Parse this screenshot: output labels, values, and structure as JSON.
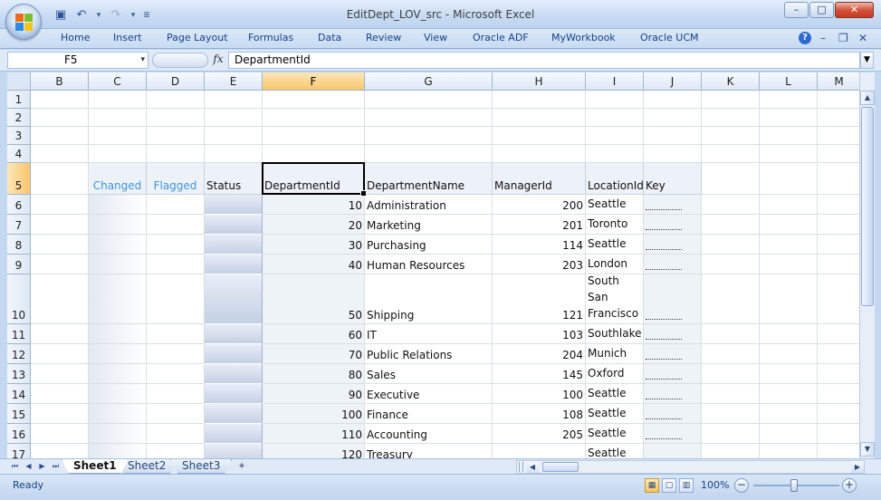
{
  "window": {
    "title": "EditDept_LOV_src - Microsoft Excel",
    "minimize_glyph": "–",
    "maximize_glyph": "□",
    "close_glyph": "✕",
    "doc_min_glyph": "–",
    "doc_restore_glyph": "❐",
    "doc_close_glyph": "✕"
  },
  "quick_access": {
    "save_icon": "▣",
    "undo_icon": "↶",
    "redo_icon": "↷",
    "dropdown_glyph": "▾",
    "customize_glyph": "≣"
  },
  "ribbon": {
    "tabs": [
      "Home",
      "Insert",
      "Page Layout",
      "Formulas",
      "Data",
      "Review",
      "View",
      "Oracle ADF",
      "MyWorkbook",
      "Oracle UCM"
    ],
    "help_icon": "?"
  },
  "formula_bar": {
    "name_box": "F5",
    "name_box_dropdown": "▾",
    "fx_label": "fx",
    "content": "DepartmentId",
    "expand_glyph": "▼"
  },
  "columns": [
    "B",
    "C",
    "D",
    "E",
    "F",
    "G",
    "H",
    "I",
    "J",
    "K",
    "L",
    "M"
  ],
  "selected_column": "F",
  "rows": [
    "1",
    "2",
    "3",
    "4",
    "5",
    "6",
    "7",
    "8",
    "9",
    "10",
    "11",
    "12",
    "13",
    "14",
    "15",
    "16",
    "17"
  ],
  "selected_row": "5",
  "table": {
    "headers": {
      "changed": "Changed",
      "flagged": "Flagged",
      "status": "Status",
      "department_id": "DepartmentId",
      "department_name": "DepartmentName",
      "manager_id": "ManagerId",
      "location_id": "LocationId",
      "key": "Key"
    },
    "records": [
      {
        "department_id": "10",
        "department_name": "Administration",
        "manager_id": "200",
        "location": "Seattle"
      },
      {
        "department_id": "20",
        "department_name": "Marketing",
        "manager_id": "201",
        "location": "Toronto"
      },
      {
        "department_id": "30",
        "department_name": "Purchasing",
        "manager_id": "114",
        "location": "Seattle"
      },
      {
        "department_id": "40",
        "department_name": "Human Resources",
        "manager_id": "203",
        "location": "London"
      },
      {
        "department_id": "50",
        "department_name": "Shipping",
        "manager_id": "121",
        "location": "South San Francisco"
      },
      {
        "department_id": "60",
        "department_name": "IT",
        "manager_id": "103",
        "location": "Southlake"
      },
      {
        "department_id": "70",
        "department_name": "Public Relations",
        "manager_id": "204",
        "location": "Munich"
      },
      {
        "department_id": "80",
        "department_name": "Sales",
        "manager_id": "145",
        "location": "Oxford"
      },
      {
        "department_id": "90",
        "department_name": "Executive",
        "manager_id": "100",
        "location": "Seattle"
      },
      {
        "department_id": "100",
        "department_name": "Finance",
        "manager_id": "108",
        "location": "Seattle"
      },
      {
        "department_id": "110",
        "department_name": "Accounting",
        "manager_id": "205",
        "location": "Seattle"
      },
      {
        "department_id": "120",
        "department_name": "Treasury",
        "manager_id": "",
        "location": "Seattle"
      }
    ]
  },
  "sheets": {
    "tabs": [
      "Sheet1",
      "Sheet2",
      "Sheet3"
    ],
    "active": "Sheet1",
    "nav_first": "⏮",
    "nav_prev": "◀",
    "nav_next": "▶",
    "nav_last": "⏭",
    "new_sheet_icon": "✦"
  },
  "scroll": {
    "up_glyph": "▲",
    "down_glyph": "▼",
    "left_glyph": "◀",
    "right_glyph": "▶"
  },
  "status_bar": {
    "status": "Ready",
    "view_normal_icon": "▦",
    "view_layout_icon": "▢",
    "view_break_icon": "▥",
    "zoom": "100%",
    "zoom_out_glyph": "−",
    "zoom_in_glyph": "+"
  },
  "colors": {
    "accent_header_text": "#3a96d8",
    "frame": "#c4d8f0",
    "selected_header": "#f9c66d"
  }
}
